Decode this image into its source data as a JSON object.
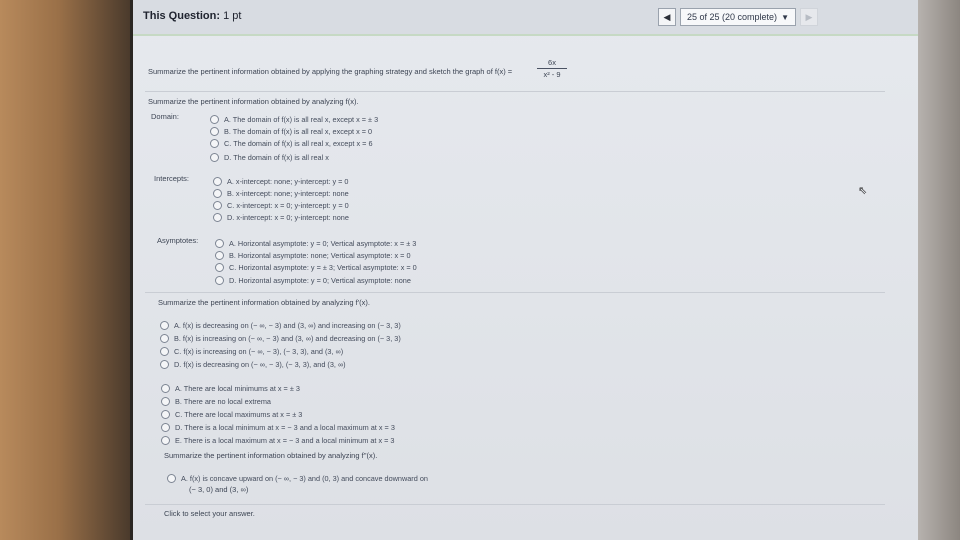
{
  "header": {
    "question_label": "This Question:",
    "points": "1 pt",
    "progress": "25 of 25 (20 complete)",
    "prev_icon": "triangle-left-icon",
    "next_icon": "triangle-right-icon",
    "dropdown_icon": "caret-down-icon"
  },
  "prompt": {
    "text": "Summarize the pertinent information obtained by applying the graphing strategy and sketch the graph of f(x) =",
    "numerator": "6x",
    "denominator": "x² - 9"
  },
  "part1": {
    "heading": "Summarize the pertinent information obtained by analyzing f(x).",
    "domain": {
      "label": "Domain:",
      "options": [
        "A.  The domain of f(x) is all real x, except x = ± 3",
        "B.  The domain of f(x) is all real x, except x = 0",
        "C.  The domain of f(x) is all real x, except x = 6",
        "D.  The domain of f(x) is all real x"
      ]
    },
    "intercepts": {
      "label": "Intercepts:",
      "options": [
        "A.  x-intercept: none;  y-intercept: y = 0",
        "B.  x-intercept: none;  y-intercept: none",
        "C.  x-intercept: x = 0;  y-intercept: y = 0",
        "D.  x-intercept: x = 0;  y-intercept: none"
      ]
    },
    "asymptotes": {
      "label": "Asymptotes:",
      "options": [
        "A.  Horizontal asymptote: y = 0;  Vertical asymptote: x = ± 3",
        "B.  Horizontal asymptote: none;  Vertical asymptote: x = 0",
        "C.  Horizontal asymptote: y = ± 3;  Vertical asymptote: x = 0",
        "D.  Horizontal asymptote: y = 0;  Vertical asymptote: none"
      ]
    }
  },
  "part2": {
    "heading": "Summarize the pertinent information obtained by analyzing f'(x).",
    "monotonic": [
      "A.  f(x) is decreasing on (− ∞, − 3) and (3, ∞) and increasing on (− 3, 3)",
      "B.  f(x) is increasing on (− ∞, − 3) and (3, ∞) and decreasing on (− 3, 3)",
      "C.  f(x) is increasing on (− ∞, − 3), (− 3, 3), and (3, ∞)",
      "D.  f(x) is decreasing on (− ∞, − 3), (− 3, 3), and (3, ∞)"
    ],
    "extrema": [
      "A.  There are local minimums at x = ± 3",
      "B.  There are no local extrema",
      "C.  There are local maximums at x = ± 3",
      "D.  There is a local minimum at x = − 3 and a local maximum at x = 3",
      "E.  There is a local maximum at x = − 3 and a local minimum at x = 3"
    ]
  },
  "part3": {
    "heading": "Summarize the pertinent information obtained by analyzing f''(x).",
    "option_a_line1": "A.  f(x) is concave upward on (− ∞, − 3) and (0, 3) and concave downward on",
    "option_a_line2": "(− 3, 0) and (3, ∞)"
  },
  "footer": {
    "hint": "Click to select your answer."
  }
}
